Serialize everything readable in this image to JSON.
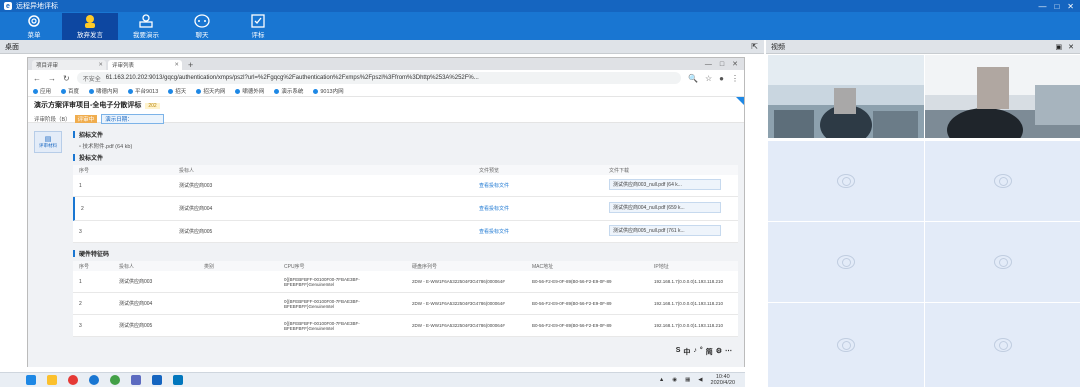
{
  "app": {
    "title": "远程异地评标",
    "controls": [
      "—",
      "□",
      "✕"
    ]
  },
  "toolbar": [
    {
      "label": "菜单",
      "icon": "gear-icon"
    },
    {
      "label": "放弃发言",
      "icon": "user-avatar-icon",
      "active": true
    },
    {
      "label": "我要演示",
      "icon": "presenter-icon"
    },
    {
      "label": "聊天",
      "icon": "chat-icon"
    },
    {
      "label": "评标",
      "icon": "evaluate-icon"
    }
  ],
  "desktop_panel": {
    "title": "桌面"
  },
  "video_panel": {
    "title": "视频"
  },
  "browser": {
    "tabs": [
      {
        "label": "项目评审"
      },
      {
        "label": "评审列表",
        "active": true
      }
    ],
    "new_tab": "+",
    "url_security": "不安全",
    "url": "61.163.210.202:9013/gqcg/authentication/xmps/pszl?url=%2Fgqcg%2Fauthentication%2Fxmps%2Fpszl%3Ffrom%3Dhttp%253A%252F%...",
    "bookmarks": [
      "应用",
      "百度",
      "啸德内网",
      "平台9013",
      "招天",
      "招天内网",
      "啸德外网",
      "演示系统",
      "9013内网"
    ]
  },
  "page": {
    "title": "演示方案评审项目-全电子分散评标",
    "title_badge": "202",
    "sub_label": "评审阶段（B）",
    "sub_badge": "评审中",
    "sub_status": "演示日期：",
    "side_label": "评审材料",
    "sec_bid_doc": "招标文件",
    "bid_doc_file": "技术附件.pdf (64 kb)",
    "sec_tender": "投标文件",
    "tender_headers": [
      "序号",
      "投标人",
      "文件预览",
      "文件下载"
    ],
    "tender_rows": [
      {
        "no": "1",
        "bidder": "测试供应商003",
        "preview": "查看投标文件",
        "download": "测试供应商003_null.pdf (64 k..."
      },
      {
        "no": "2",
        "bidder": "测试供应商004",
        "preview": "查看投标文件",
        "download": "测试供应商004_null.pdf (659 k..."
      },
      {
        "no": "3",
        "bidder": "测试供应商005",
        "preview": "查看投标文件",
        "download": "测试供应商005_null.pdf (761 k..."
      }
    ],
    "sec_hardware": "硬件特征码",
    "hw_headers": [
      "序号",
      "投标人",
      "类别",
      "CPU序号",
      "硬盘序列号",
      "MAC地址",
      "IP地址"
    ],
    "hw_rows": [
      {
        "no": "1",
        "bidder": "测试供应商003",
        "type": "",
        "cpu": "0{{BFEBFBFF-00100F00-7FBAE3BF-BFEBFBFF}GenuineIntel",
        "disk": "2DW - E-WW1F6A5322504#3G4786(000064#",
        "mac": "B0-56-F2-E9-0F-89(B0-56-F2-E9-0F-89",
        "ip": "192.168.1.7(0.0.0.0)1.193.118.210"
      },
      {
        "no": "2",
        "bidder": "测试供应商004",
        "type": "",
        "cpu": "0{{BFEBFBFF-00100F00-7FBAE3BF-BFEBFBFF}GenuineIntel",
        "disk": "2DW - E-WW1F6A5322504#3G4786(000064#",
        "mac": "B0-56-F2-E9-0F-89(B0-56-F2-E9-0F-89",
        "ip": "192.168.1.7(0.0.0.0)1.193.118.210"
      },
      {
        "no": "3",
        "bidder": "测试供应商005",
        "type": "",
        "cpu": "0{{BFEBFBFF-00100F00-7FBAE3BF-BFEBFBFF}GenuineIntel",
        "disk": "2DW - E-WW1F6A5322504#3G4786(000064#",
        "mac": "B0-56-F2-E9-0F-89(B0-56-F2-E9-0F-89",
        "ip": "192.168.1.7(0.0.0.0)1.193.118.210"
      }
    ],
    "ime": [
      "S",
      "中",
      "♪",
      "°",
      "简",
      "⚙",
      "⋯"
    ]
  },
  "taskbar": {
    "time": "10:40",
    "date": "2020/4/20"
  }
}
